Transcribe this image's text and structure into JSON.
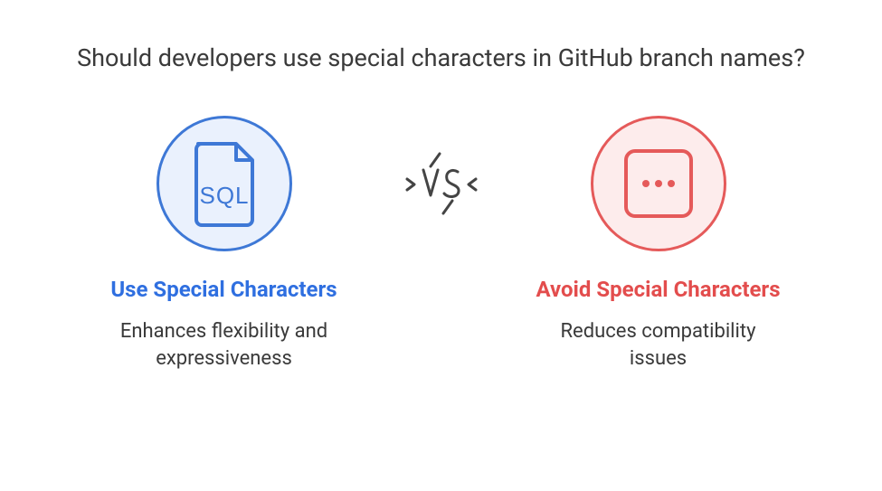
{
  "heading": "Should developers use special characters in GitHub branch names?",
  "left": {
    "title": "Use Special Characters",
    "desc": "Enhances flexibility and expressiveness",
    "icon_label": "SQL"
  },
  "right": {
    "title": "Avoid Special Characters",
    "desc": "Reduces compatibility issues"
  },
  "vs_label": "VS"
}
